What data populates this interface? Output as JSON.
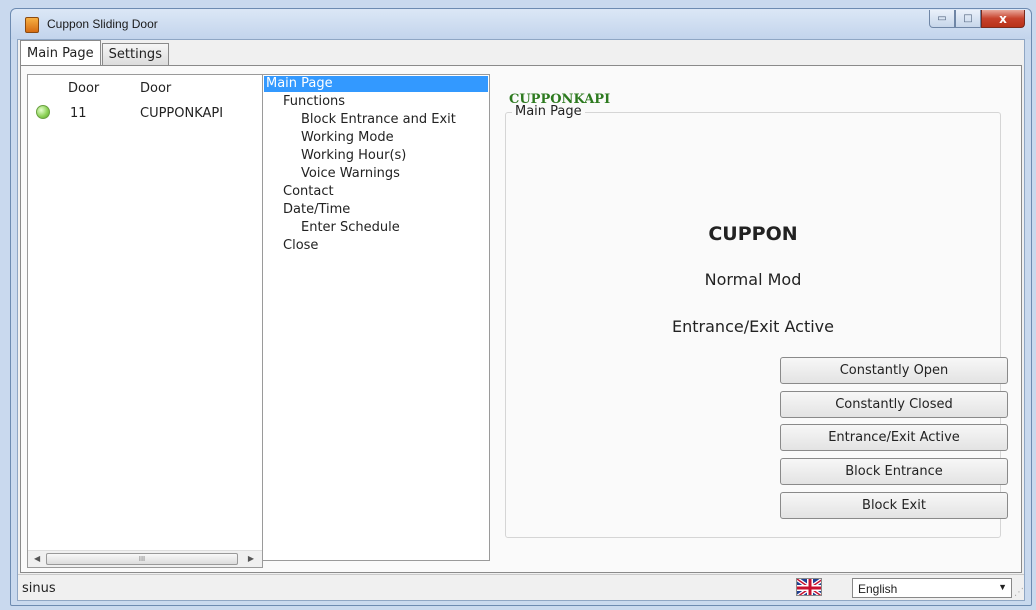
{
  "window": {
    "title": "Cuppon Sliding Door",
    "controls": {
      "minimize": "▭",
      "maximize": "□",
      "close": "x"
    }
  },
  "tabs": [
    {
      "label": "Main Page",
      "active": true
    },
    {
      "label": "Settings",
      "active": false
    }
  ],
  "door_list": {
    "columns": [
      "Door",
      "Door"
    ],
    "rows": [
      {
        "status": "online",
        "number": "11",
        "name": "CUPPONKAPI"
      }
    ],
    "scroll_thumb_label": "III"
  },
  "nav_tree": {
    "items": [
      {
        "label": "Main Page",
        "selected": true
      },
      {
        "label": "Functions"
      },
      {
        "label": "Block Entrance and Exit"
      },
      {
        "label": "Working Mode"
      },
      {
        "label": "Working Hour(s)"
      },
      {
        "label": "Voice Warnings"
      },
      {
        "label": "Contact"
      },
      {
        "label": "Date/Time"
      },
      {
        "label": "Enter Schedule"
      },
      {
        "label": "Close"
      }
    ]
  },
  "content": {
    "device_name": "CUPPONKAPI",
    "group_title": "Main Page",
    "brand": "CUPPON",
    "mode_status": "Normal Mod",
    "access_status": "Entrance/Exit Active",
    "buttons": [
      "Constantly Open",
      "Constantly Closed",
      "Entrance/Exit Active",
      "Block Entrance",
      "Block Exit"
    ]
  },
  "statusbar": {
    "left_text": "sinus",
    "language": "English",
    "flag_icon": "uk-flag-icon"
  },
  "colors": {
    "accent_green": "#2d7a1f",
    "selection_blue": "#3399ff"
  }
}
